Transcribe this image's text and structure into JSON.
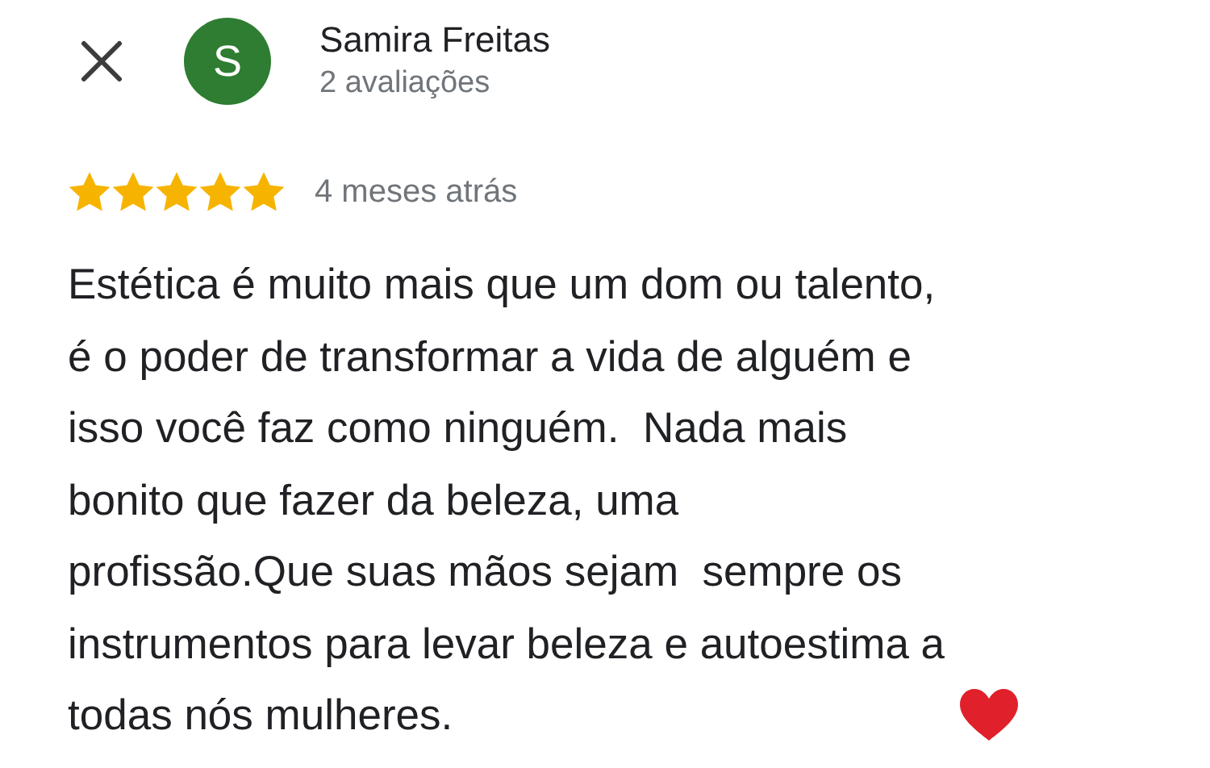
{
  "reviewer": {
    "name": "Samira Freitas",
    "initial": "S",
    "color": "#2e7d32",
    "review_count": "2 avaliações"
  },
  "review": {
    "stars": 5,
    "time": "4 meses atrás",
    "text": "Estética é muito mais que um dom ou talento,\né o poder de transformar a vida de alguém e\nisso você faz como ninguém.  Nada mais\nbonito que fazer da beleza, uma\nprofissão.Que suas mãos sejam  sempre os\ninstrumentos para levar beleza e autoestima a\ntodas nós mulheres."
  }
}
